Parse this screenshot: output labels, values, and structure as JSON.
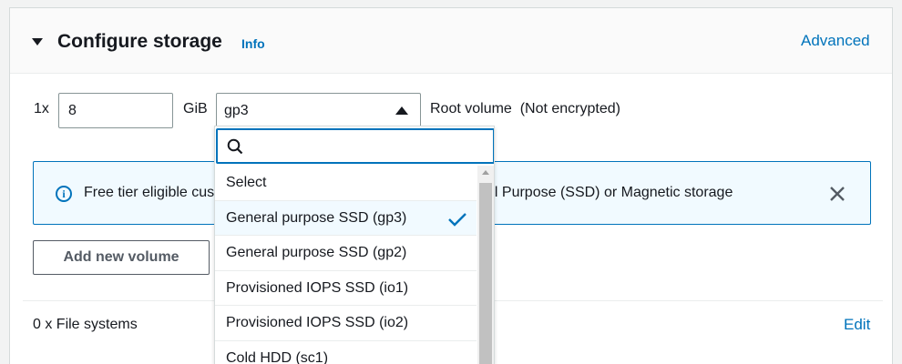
{
  "header": {
    "title": "Configure storage",
    "info_link": "Info",
    "advanced_link": "Advanced"
  },
  "volume": {
    "quantity_label": "1x",
    "size_value": "8",
    "unit": "GiB",
    "type_value": "gp3",
    "description": "Root volume  (Not encrypted)"
  },
  "alert": {
    "text": "Free tier eligible customers can get up to 30 GB of EBS General Purpose (SSD) or Magnetic storage"
  },
  "add_volume_label": "Add new volume",
  "file_systems_label": "0 x File systems",
  "edit_link": "Edit",
  "dropdown": {
    "search_value": "",
    "options": [
      {
        "label": "Select",
        "selected": false
      },
      {
        "label": "General purpose SSD (gp3)",
        "selected": true
      },
      {
        "label": "General purpose SSD (gp2)",
        "selected": false
      },
      {
        "label": "Provisioned IOPS SSD (io1)",
        "selected": false
      },
      {
        "label": "Provisioned IOPS SSD (io2)",
        "selected": false
      },
      {
        "label": "Cold HDD (sc1)",
        "selected": false
      }
    ]
  },
  "colors": {
    "link": "#0073bb",
    "alert_bg": "#f1faff",
    "text": "#16191f"
  }
}
